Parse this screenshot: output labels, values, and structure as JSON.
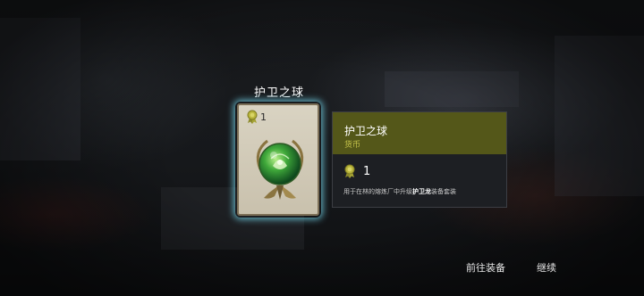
{
  "item": {
    "title": "护卫之球",
    "card_count": "1"
  },
  "detail_panel": {
    "name": "护卫之球",
    "type": "货币",
    "count": "1",
    "description_prefix": "用于在林的熔炼厂中升级",
    "description_highlight": "护卫龙",
    "description_suffix": "装备套装"
  },
  "actions": {
    "go_to_equipment": "前往装备",
    "continue": "继续"
  },
  "icons": {
    "currency": "medal-icon",
    "item": "green-orb-icon"
  },
  "colors": {
    "panel_header": "#545719",
    "type_text": "#c4c24a",
    "card_glow": "#6ec8dc"
  }
}
